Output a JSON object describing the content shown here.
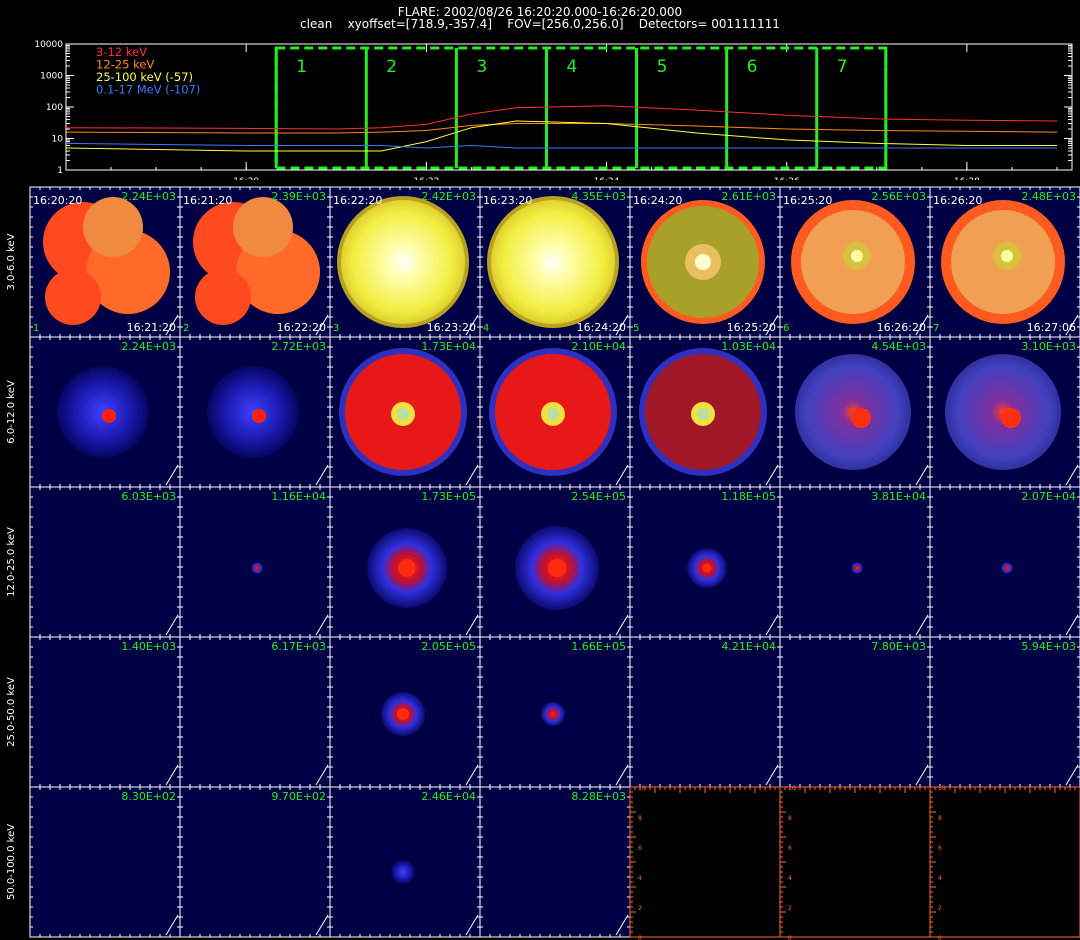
{
  "header": {
    "line1": "FLARE: 2002/08/26 16:20:20.000-16:26:20.000",
    "line2": "clean    xyoffset=[718.9,-357.4]    FOV=[256.0,256.0]    Detectors= 001111111"
  },
  "chart_data": [
    {
      "type": "line",
      "title": "",
      "yscale": "log",
      "ylim": [
        1,
        10000
      ],
      "y_ticks": [
        "1",
        "10",
        "100",
        "1000",
        "10000"
      ],
      "x_ticks": [
        "16:20",
        "16:22",
        "16:24",
        "16:26",
        "16:28"
      ],
      "x_range": [
        "16:18:00",
        "16:29:10"
      ],
      "legend_position": "top-left",
      "series": [
        {
          "name": "3-12 keV",
          "color": "#ff3030",
          "x": [
            "16:18",
            "16:20",
            "16:21",
            "16:21:30",
            "16:22",
            "16:22:30",
            "16:23",
            "16:24",
            "16:25",
            "16:26",
            "16:27",
            "16:28",
            "16:29"
          ],
          "values": [
            22,
            21,
            20,
            22,
            28,
            60,
            95,
            110,
            80,
            55,
            42,
            38,
            36
          ]
        },
        {
          "name": "12-25 keV",
          "color": "#ff8a1a",
          "x": [
            "16:18",
            "16:20",
            "16:21",
            "16:21:30",
            "16:22",
            "16:22:30",
            "16:23",
            "16:24",
            "16:25",
            "16:26",
            "16:27",
            "16:28",
            "16:29"
          ],
          "values": [
            16,
            15,
            15,
            16,
            18,
            26,
            30,
            30,
            25,
            20,
            18,
            17,
            16
          ]
        },
        {
          "name": "25-100 keV (-57)",
          "color": "#ffff40",
          "x": [
            "16:18",
            "16:20",
            "16:21",
            "16:21:30",
            "16:22",
            "16:22:30",
            "16:23",
            "16:24",
            "16:25",
            "16:26",
            "16:27",
            "16:28",
            "16:29"
          ],
          "values": [
            5,
            4,
            4,
            4,
            8,
            22,
            36,
            30,
            15,
            9,
            7,
            6,
            6
          ]
        },
        {
          "name": "0.1-17 MeV (-107)",
          "color": "#3a7aff",
          "x": [
            "16:18",
            "16:20",
            "16:21",
            "16:21:30",
            "16:22",
            "16:22:30",
            "16:23",
            "16:24",
            "16:25",
            "16:26",
            "16:27",
            "16:28",
            "16:29"
          ],
          "values": [
            7,
            6,
            6,
            6,
            5,
            6,
            5,
            5,
            5,
            5,
            5,
            5,
            5
          ]
        }
      ],
      "intervals": [
        "1",
        "2",
        "3",
        "4",
        "5",
        "6",
        "7"
      ],
      "interval_color": "#22ee22"
    },
    {
      "type": "heatmap",
      "row_labels": [
        "3.0-6.0 keV",
        "6.0-12.0 keV",
        "12.0-25.0 keV",
        "25.0-50.0 keV",
        "50.0-100.0 keV"
      ],
      "start_times": [
        "16:20:20",
        "16:21:20",
        "16:22:20",
        "16:23:20",
        "16:24:20",
        "16:25:20",
        "16:26:20"
      ],
      "end_times": [
        "16:21:20",
        "16:22:20",
        "16:23:20",
        "16:24:20",
        "16:25:20",
        "16:26:20",
        "16:27:06"
      ],
      "interval_numbers": [
        "1",
        "2",
        "3",
        "4",
        "5",
        "6",
        "7"
      ],
      "peaks": [
        [
          "2.24E+03",
          "2.39E+03",
          "2.42E+03",
          "4.35E+03",
          "2.61E+03",
          "2.56E+03",
          "2.48E+03"
        ],
        [
          "2.24E+03",
          "2.72E+03",
          "1.73E+04",
          "2.10E+04",
          "1.03E+04",
          "4.54E+03",
          "3.10E+03"
        ],
        [
          "6.03E+03",
          "1.16E+04",
          "1.73E+05",
          "2.54E+05",
          "1.18E+05",
          "3.81E+04",
          "2.07E+04"
        ],
        [
          "1.40E+03",
          "6.17E+03",
          "2.05E+05",
          "1.66E+05",
          "4.21E+04",
          "7.80E+03",
          "5.94E+03"
        ],
        [
          "8.30E+02",
          "9.70E+02",
          "2.46E+04",
          "8.28E+03",
          "",
          "",
          ""
        ]
      ],
      "empty_panel_ticks": [
        "0",
        "2",
        "4",
        "6",
        "8",
        "10"
      ],
      "colors": {
        "peak_text": "#22ee22",
        "time_text": "#ffffff",
        "border": "#ffffff",
        "empty_border": "#ff6a2a"
      }
    }
  ]
}
